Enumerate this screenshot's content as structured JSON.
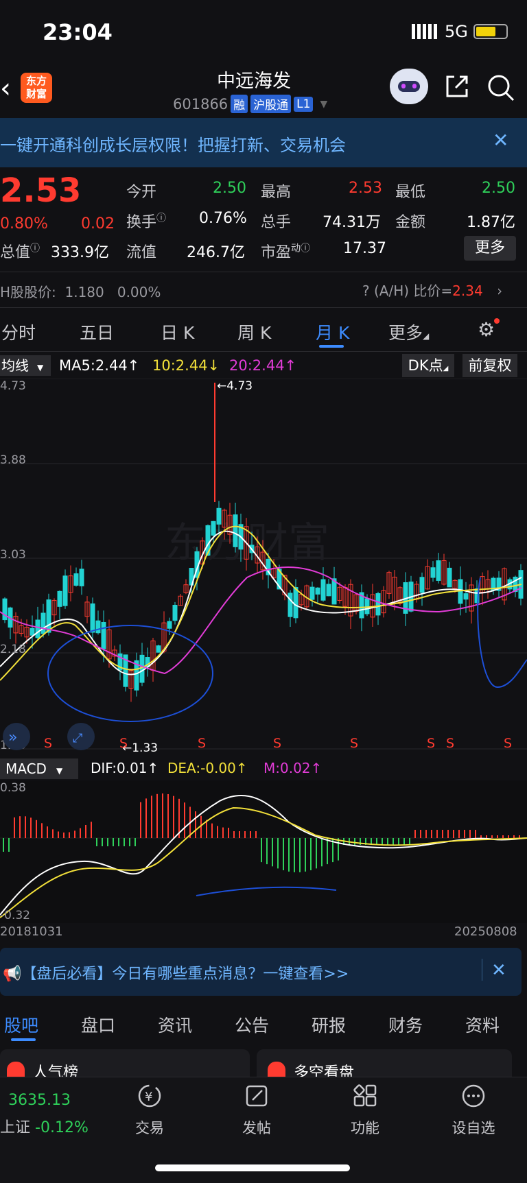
{
  "status": {
    "time": "23:04",
    "network": "5G"
  },
  "header": {
    "back_icon": "chevron-left-icon",
    "logo_text": "东方\n财富",
    "stock_name": "中远海发",
    "stock_code": "601866",
    "tags": [
      "融",
      "沪股通",
      "L1"
    ]
  },
  "banner": {
    "text": "一键开通科创成长层权限！把握打新、交易机会"
  },
  "quote": {
    "price": "2.53",
    "pct": "0.80%",
    "change": "0.02",
    "open_label": "今开",
    "open": "2.50",
    "high_label": "最高",
    "high": "2.53",
    "low_label": "最低",
    "low": "2.50",
    "turnover_label": "换手",
    "turnover": "0.76%",
    "volume_label": "总手",
    "volume": "74.31万",
    "amount_label": "金额",
    "amount": "1.87亿",
    "mcap_label": "总值",
    "mcap": "333.9亿",
    "float_label": "流值",
    "float": "246.7亿",
    "pe_label": "市盈",
    "pe_sup": "动",
    "pe": "17.37",
    "more": "更多"
  },
  "hshare": {
    "label": "H股股价:",
    "price": "1.180",
    "pct": "0.00%",
    "ah_label": "(A/H) 比价=",
    "ah_value": "2.34"
  },
  "tabs": {
    "fenshi": "分时",
    "wuri": "五日",
    "rik": "日 K",
    "zhouk": "周 K",
    "yuek": "月 K",
    "more": "更多"
  },
  "ma": {
    "select": "均线",
    "ma5": "MA5:2.44↑",
    "ma10": "10:2.44↓",
    "ma20": "20:2.44↑",
    "dk": "DK点",
    "fq": "前复权"
  },
  "kchart": {
    "y_labels": [
      "4.73",
      "3.88",
      "3.03",
      "2.18",
      "1.33"
    ],
    "max_label": "←4.73",
    "min_label": "←1.33",
    "s_marks": [
      "S",
      "S",
      "S",
      "S",
      "S",
      "S",
      "S",
      "S",
      "S"
    ]
  },
  "macd": {
    "select": "MACD",
    "dif": "DIF:0.01↑",
    "dea": "DEA:-0.00↑",
    "m": "M:0.02↑",
    "y_top": "0.38",
    "y_bottom": "-0.32"
  },
  "dates": {
    "start": "20181031",
    "end": "20250808"
  },
  "notice": {
    "text": "【盘后必看】今日有哪些重点消息？一键查看>>"
  },
  "bottom_tabs": [
    "股吧",
    "盘口",
    "资讯",
    "公告",
    "研报",
    "财务",
    "资料"
  ],
  "cards": {
    "card1": "人气榜",
    "card2": "多空看盘"
  },
  "index": {
    "value": "3635.13",
    "name": "上证",
    "pct": "-0.12%"
  },
  "nav": {
    "trade": "交易",
    "post": "发帖",
    "func": "功能",
    "watch": "设自选"
  },
  "colors": {
    "up": "#ff3b30",
    "down": "#22d3d3",
    "ma5": "#ffffff",
    "ma10": "#f2e03a",
    "ma20": "#e23cd7",
    "accent": "#3d8cff"
  }
}
